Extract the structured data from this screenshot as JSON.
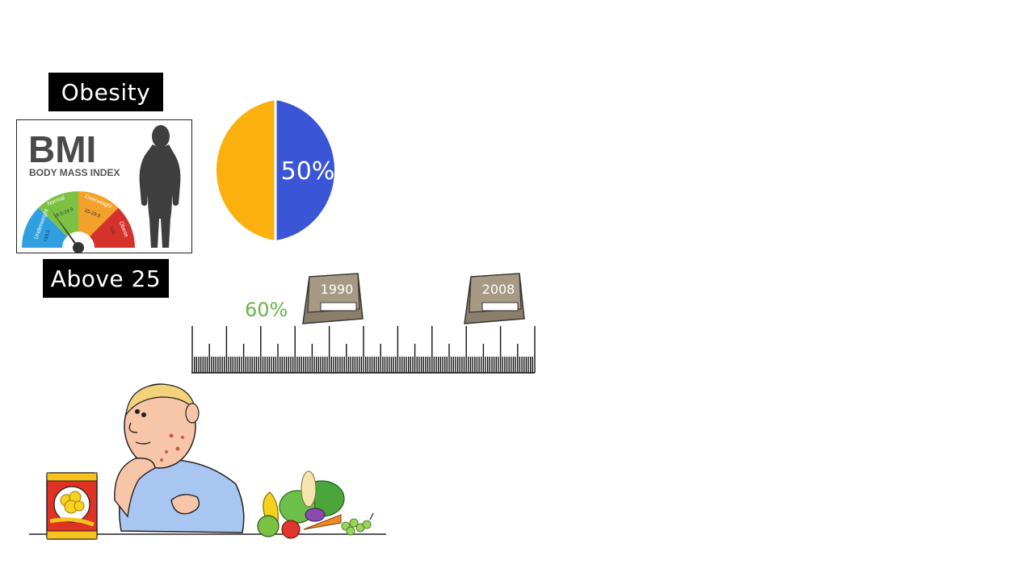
{
  "labels": {
    "obesity": "Obesity",
    "bmi_threshold": "Above 25"
  },
  "bmi_card": {
    "title": "BMI",
    "subtitle": "BODY MASS INDEX",
    "gauge_segments": [
      "Underweight",
      "Normal",
      "Overweight",
      "Obese"
    ],
    "gauge_ranges": [
      "<18.5",
      "18.5-24.9",
      "25-29.9",
      ">30"
    ],
    "colors": {
      "underweight": "#2f9fe0",
      "normal": "#7cc142",
      "overweight": "#f4a12b",
      "obese": "#d6322c"
    }
  },
  "pie": {
    "label": "50%",
    "colors": {
      "left": "#fbb00e",
      "right": "#3a56d6"
    }
  },
  "timeline": {
    "percent": "60%",
    "years": [
      "1990",
      "2008"
    ]
  },
  "colors": {
    "label_bg": "#000000",
    "label_text": "#ffffff",
    "percent_green": "#6ab44c",
    "shirt_blue": "#a9c6f2"
  },
  "icons": [
    "body-silhouette-icon",
    "bmi-gauge-icon",
    "calendar-1990-icon",
    "calendar-2008-icon",
    "chips-bag-icon",
    "vegetables-icon",
    "man-thinking-icon"
  ]
}
